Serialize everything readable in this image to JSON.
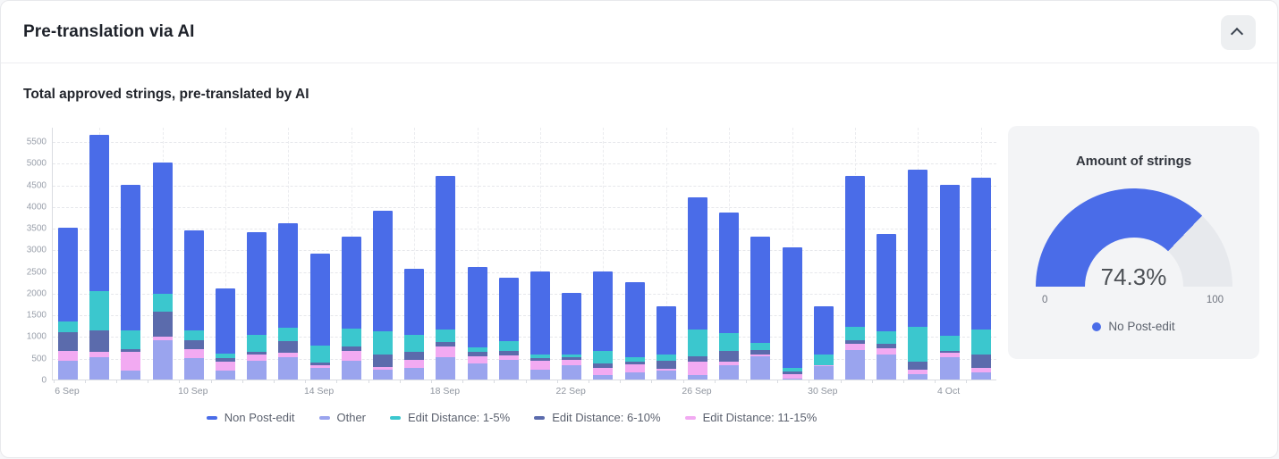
{
  "header": {
    "title": "Pre-translation via AI",
    "collapse_icon": "chevron-up-icon"
  },
  "chart": {
    "subtitle": "Total approved strings, pre-translated by AI"
  },
  "chart_data": {
    "type": "bar",
    "stacked": true,
    "categories": [
      "6 Sep",
      "7 Sep",
      "8 Sep",
      "9 Sep",
      "10 Sep",
      "11 Sep",
      "12 Sep",
      "13 Sep",
      "14 Sep",
      "15 Sep",
      "16 Sep",
      "17 Sep",
      "18 Sep",
      "19 Sep",
      "20 Sep",
      "21 Sep",
      "22 Sep",
      "23 Sep",
      "24 Sep",
      "25 Sep",
      "26 Sep",
      "27 Sep",
      "28 Sep",
      "29 Sep",
      "30 Sep",
      "1 Oct",
      "2 Oct",
      "3 Oct",
      "4 Oct",
      "5 Oct"
    ],
    "x_tick_label_indices": [
      0,
      4,
      8,
      12,
      16,
      20,
      24,
      28
    ],
    "x_tick_labels": [
      "6 Sep",
      "10 Sep",
      "14 Sep",
      "18 Sep",
      "22 Sep",
      "26 Sep",
      "30 Sep",
      "4 Oct"
    ],
    "y_ticks": [
      0,
      500,
      1000,
      1500,
      2000,
      2500,
      3000,
      3500,
      4000,
      4500,
      5000,
      5500
    ],
    "ylim": [
      0,
      5830
    ],
    "grid": true,
    "legend_position": "bottom",
    "stack_order_bottom_to_top": [
      "Other",
      "Edit Distance: 11-15%",
      "Edit Distance: 6-10%",
      "Edit Distance: 1-5%",
      "Non Post-edit"
    ],
    "series": [
      {
        "name": "Non Post-edit",
        "color": "#4a6ce8",
        "values": [
          2170,
          3600,
          3370,
          3030,
          2310,
          1500,
          2370,
          2400,
          2110,
          2125,
          2795,
          1520,
          3550,
          1850,
          1455,
          1930,
          1415,
          1850,
          1725,
          1130,
          3055,
          2770,
          2445,
          2790,
          1125,
          3490,
          2245,
          3640,
          3500,
          3500
        ]
      },
      {
        "name": "Other",
        "color": "#9aa4ee",
        "values": [
          430,
          520,
          200,
          900,
          490,
          200,
          430,
          520,
          270,
          440,
          235,
          270,
          515,
          375,
          445,
          235,
          340,
          110,
          165,
          200,
          105,
          330,
          540,
          30,
          300,
          690,
          580,
          125,
          520,
          165
        ]
      },
      {
        "name": "Edit Distance: 1-5%",
        "color": "#3bc7ce",
        "values": [
          230,
          920,
          420,
          400,
          240,
          100,
          400,
          310,
          400,
          420,
          520,
          400,
          290,
          120,
          240,
          80,
          70,
          275,
          115,
          140,
          605,
          430,
          175,
          70,
          240,
          310,
          280,
          790,
          350,
          565
        ]
      },
      {
        "name": "Edit Distance: 6-10%",
        "color": "#5b6bac",
        "values": [
          450,
          500,
          80,
          590,
          200,
          90,
          60,
          270,
          50,
          105,
          290,
          170,
          105,
          85,
          105,
          60,
          70,
          105,
          50,
          190,
          125,
          240,
          110,
          70,
          10,
          70,
          100,
          190,
          30,
          315
        ]
      },
      {
        "name": "Edit Distance: 11-15%",
        "color": "#f2aaf2",
        "values": [
          220,
          110,
          430,
          80,
          210,
          210,
          140,
          100,
          70,
          210,
          60,
          190,
          240,
          170,
          105,
          195,
          105,
          160,
          195,
          40,
          310,
          80,
          30,
          90,
          25,
          140,
          145,
          105,
          100,
          105
        ]
      }
    ]
  },
  "gauge": {
    "title": "Amount of strings",
    "value": 74.3,
    "value_label": "74.3%",
    "min_label": "0",
    "max_label": "100",
    "legend_label": "No Post-edit",
    "color": "#4a6ce8",
    "track_color": "#e7e9ed"
  }
}
